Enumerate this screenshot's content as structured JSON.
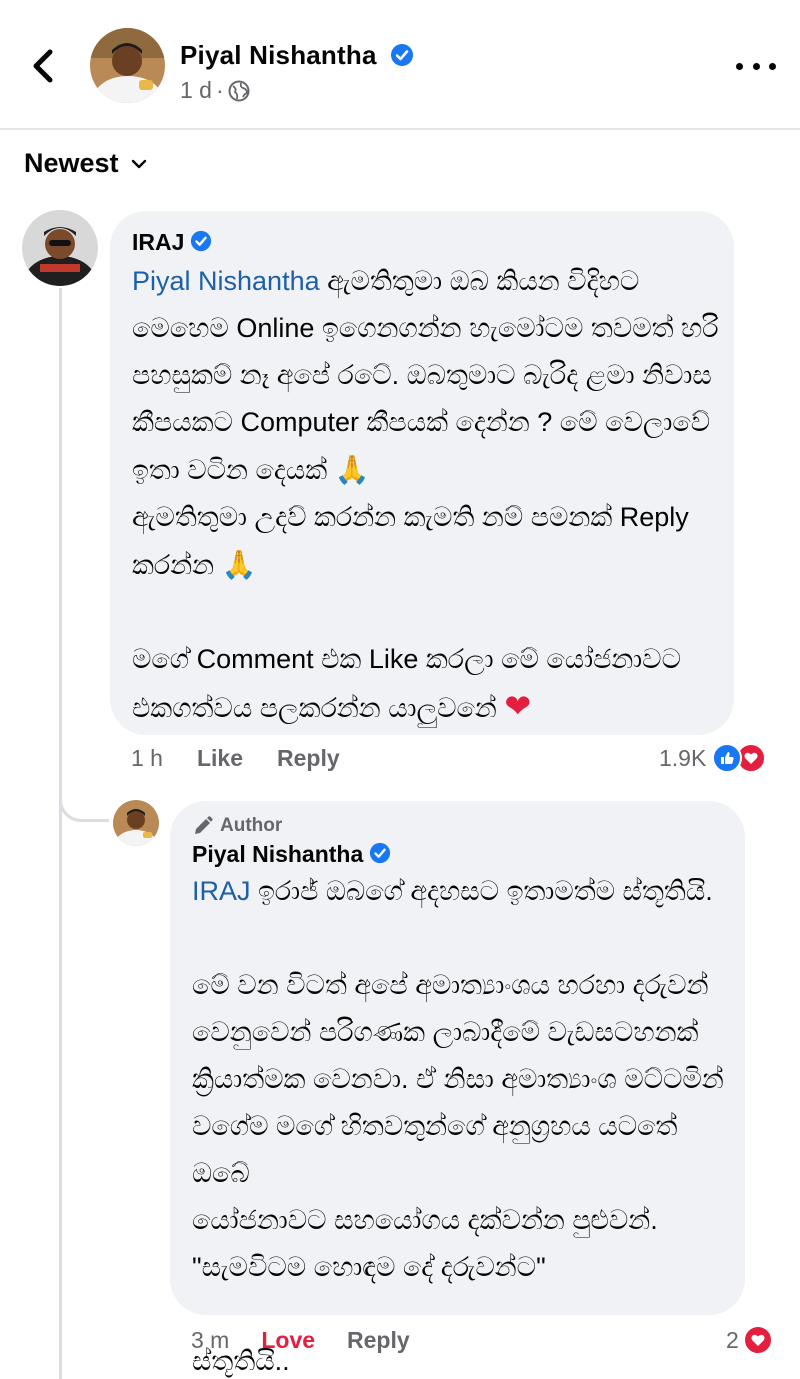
{
  "header": {
    "name": "Piyal Nishantha",
    "time": "1 d",
    "separator": "·",
    "visibility_icon": "globe-icon"
  },
  "sort": {
    "label": "Newest"
  },
  "comments": [
    {
      "author": "IRAJ",
      "verified": true,
      "lines": [
        {
          "mention": "Piyal Nishantha",
          "text": "  ඇමතිතුමා ඔබ කියන විදිහට"
        },
        {
          "text": "මෙහෙම Online ඉගෙනගන්න හැමෝටම තවමත් හරි"
        },
        {
          "text": "පහසුකම් නෑ අපේ රටේ. ඔබතුමාට බැරිද ළමා නිවාස"
        },
        {
          "text": "කීපයකට Computer කීපයක් දෙන්න ? මේ වෙලාවේ"
        },
        {
          "text": "ඉතා වටින දෙයක් ",
          "emoji": "🙏"
        },
        {
          "text": "ඇමතිතුමා උදව් කරන්න කැමති නම් පමනක් Reply"
        },
        {
          "text": "කරන්න ",
          "emoji": "🙏"
        },
        {
          "text": ""
        },
        {
          "text": "මගේ Comment එක Like කරලා මේ යෝජනාවට"
        },
        {
          "text": "එකගත්වය පලකරන්න යාලුවනේ ",
          "heart": "❤"
        }
      ],
      "time": "1 h",
      "like_label": "Like",
      "reply_label": "Reply",
      "reaction_count": "1.9K",
      "reaction_icons": [
        "like-reaction-icon",
        "love-reaction-icon"
      ]
    }
  ],
  "reply": {
    "badge": "Author",
    "author": "Piyal Nishantha",
    "verified": true,
    "lines": [
      {
        "mention": "IRAJ",
        "text": " ඉරාජ් ඔබගේ අදහසට ඉතාමත්ම ස්තූතියි."
      },
      {
        "text": ""
      },
      {
        "text": "මේ වන විටත් අපේ අමාත්‍යාංශය හරහා දරුවන්"
      },
      {
        "text": "වෙනුවෙන් පරිගණක ලාබාදීමේ වැඩසටහනක්"
      },
      {
        "text": "ක්‍රියාත්මක වෙනවා. ඒ නිසා අමාත්‍යාංශ මට්ටමින්"
      },
      {
        "text": "වගේම මගේ හිතවතුන්ගේ අනුග්‍රහය යටතේ ඔබේ"
      },
      {
        "text": "යෝජනාවට සහයෝගය දක්වන්න පුළුවන්."
      },
      {
        "text": "\"සැමවිටම හොඳම දේ දරුවන්ට\""
      },
      {
        "text": ""
      },
      {
        "text": "ස්තූතියි.."
      }
    ],
    "time": "3 m",
    "love_label": "Love",
    "reply_label": "Reply",
    "reaction_count": "2",
    "reaction_icon": "love-reaction-icon"
  },
  "colors": {
    "mention": "#1d5fa8",
    "love": "#e41e3f",
    "like_blue": "#1877f2",
    "verified": "#1877f2",
    "bubble": "#f0f2f5",
    "muted": "#65676b"
  }
}
